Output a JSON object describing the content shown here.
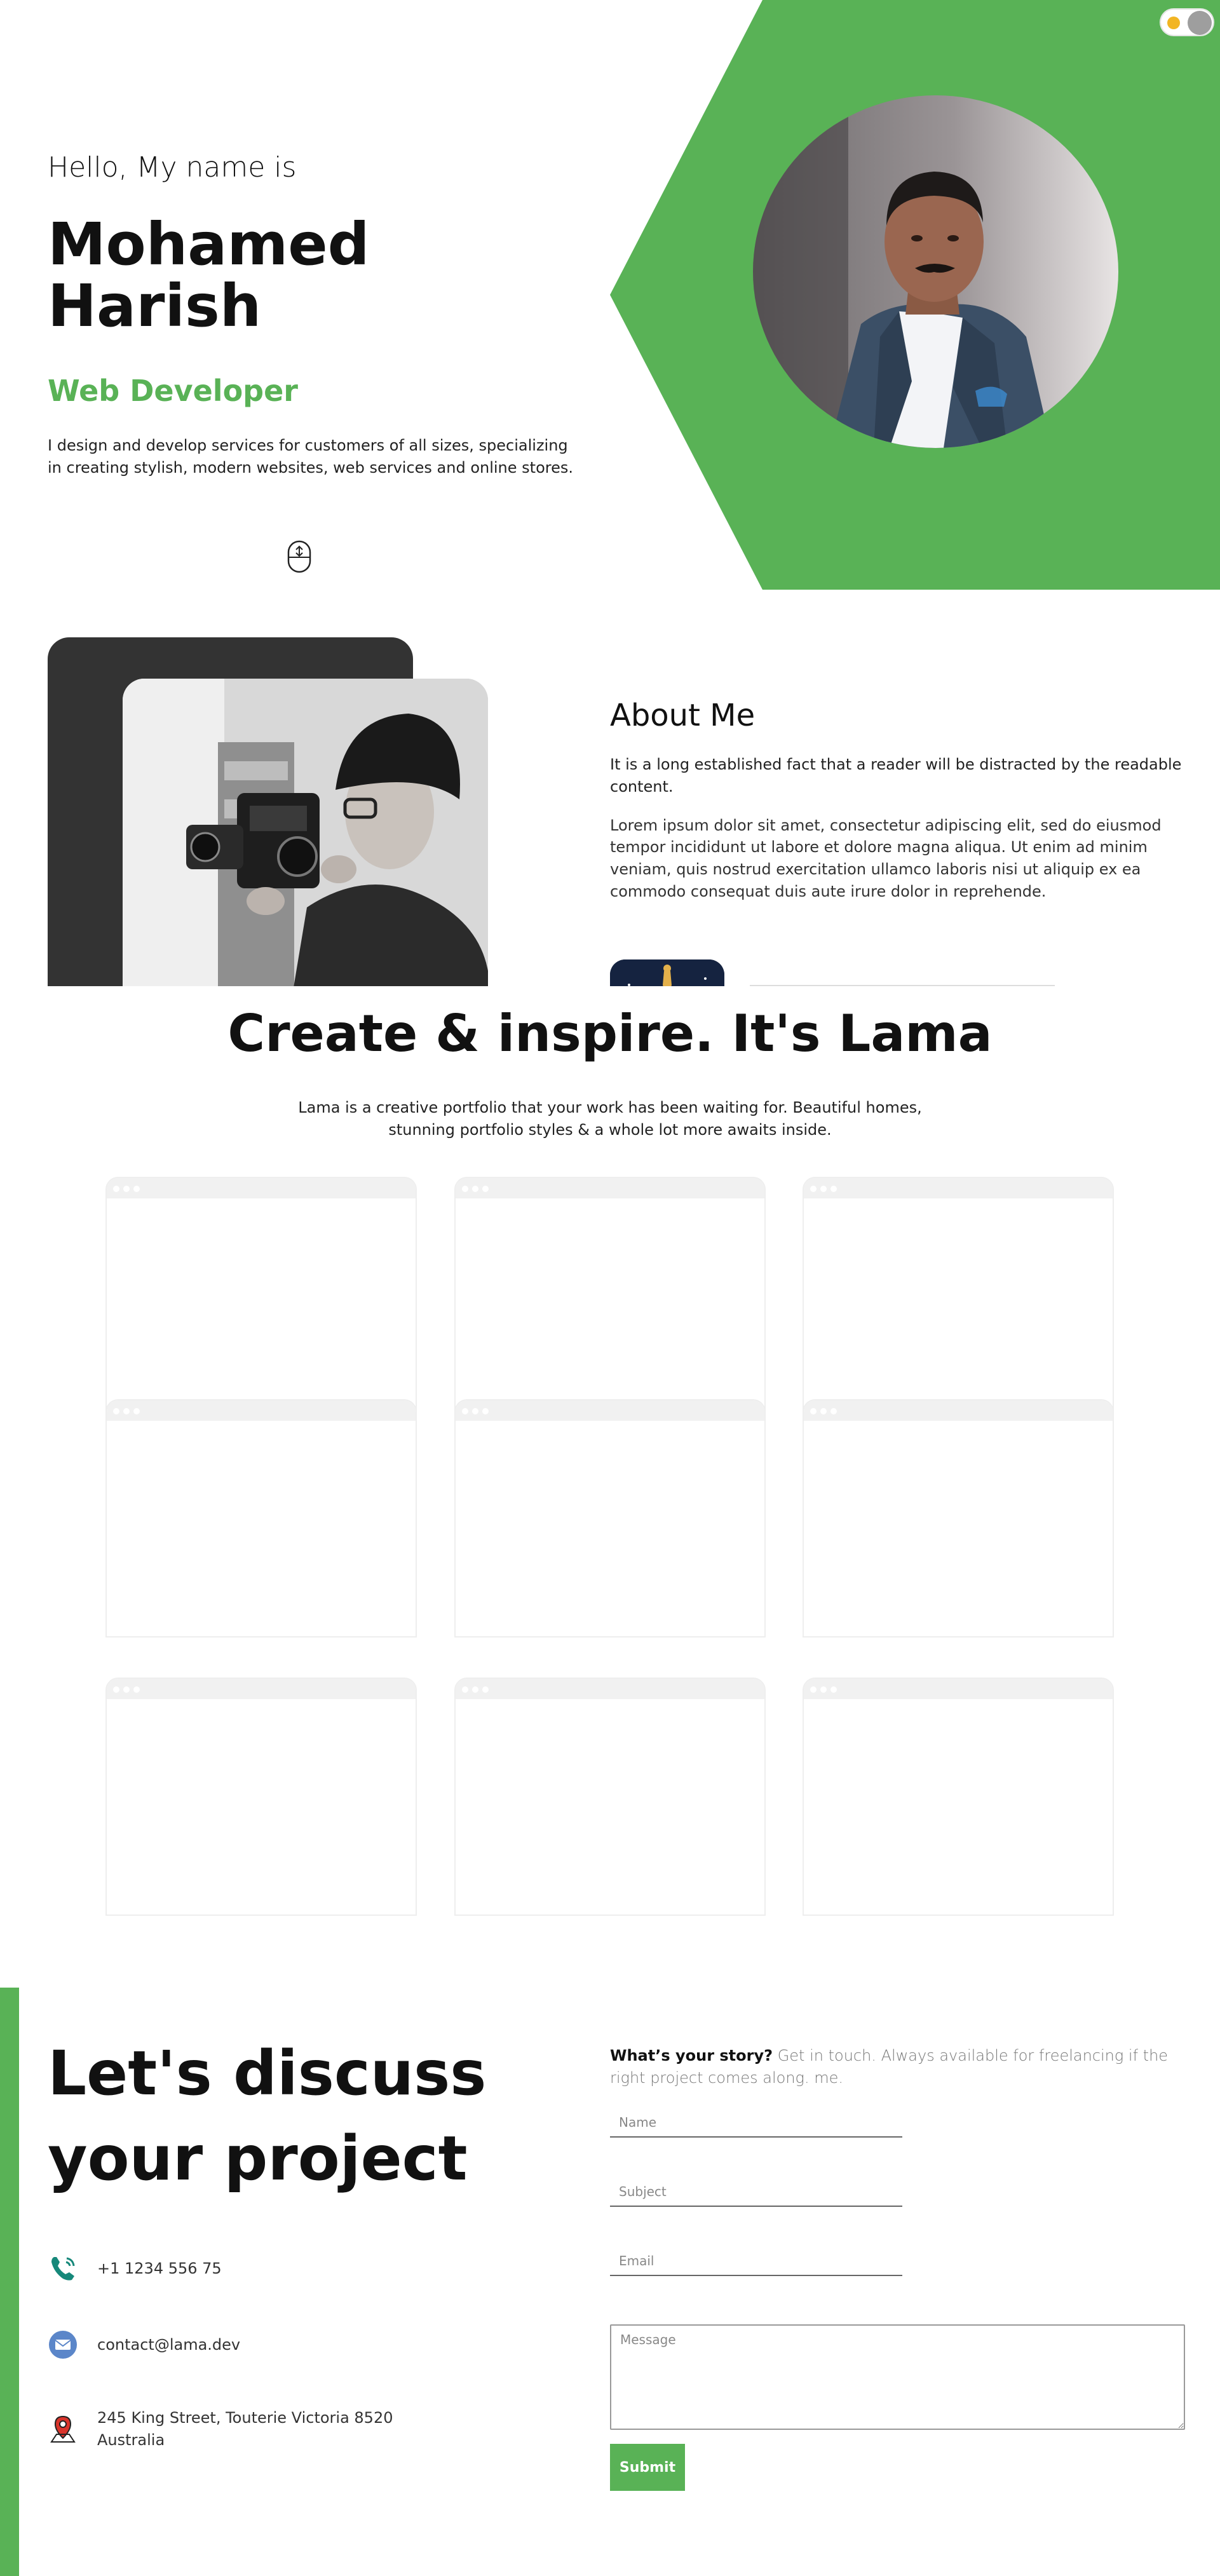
{
  "hero": {
    "greeting": "Hello, My name is",
    "name": "Mohamed Harish",
    "role": "Web Developer",
    "description": "I design and develop services for customers of all sizes, specializing in creating stylish, modern websites, web services and online stores.",
    "accent_color": "#59b256",
    "scroll_icon": "mouse-scroll-icon",
    "theme_toggle": {
      "sun_icon": "sun-icon",
      "state": "light"
    }
  },
  "about": {
    "title": "About Me",
    "subtitle": "It is a long established fact that a reader will be distracted by the readable content.",
    "description": "Lorem ipsum dolor sit amet, consectetur adipiscing elit, sed do eiusmod tempor incididunt ut labore et dolore magna aliqua. Ut enim ad minim veniam, quis nostrud exercitation ullamco laboris nisi ut aliquip ex ea commodo consequat duis aute irure dolor in reprehende."
  },
  "portfolio": {
    "title": "Create & inspire. It's Lama",
    "description": "Lama is a creative portfolio that your work has been waiting for. Beautiful homes, stunning portfolio styles & a whole lot more awaits inside.",
    "card_count": 9
  },
  "contact": {
    "title": "Let's discuss your project",
    "phone": "+1 1234 556 75",
    "email": "contact@lama.dev",
    "address": "245 King Street, Touterie Victoria 8520 Australia",
    "intro_bold": "What’s your story?",
    "intro_light": "Get in touch. Always available for freelancing if the right project comes along. me.",
    "form": {
      "name_placeholder": "Name",
      "subject_placeholder": "Subject",
      "email_placeholder": "Email",
      "message_placeholder": "Message",
      "submit_label": "Submit"
    },
    "icons": {
      "phone": "phone-icon",
      "email": "mail-icon",
      "address": "location-pin-icon"
    }
  }
}
